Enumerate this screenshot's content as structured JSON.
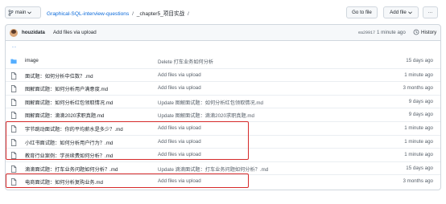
{
  "colors": {
    "link": "#0969da",
    "folder": "#54aeff",
    "highlight": "#d62a2a",
    "muted": "#57606a"
  },
  "header": {
    "branch": "main",
    "breadcrumb": {
      "repo": "Graphical-SQL-interview-questions",
      "folder": "_chapter5_项目实战",
      "trail": "/"
    },
    "goto_label": "Go to file",
    "addfile_label": "Add file",
    "more_label": "···"
  },
  "latest_commit": {
    "author": "houzidata",
    "message": "Add files via upload",
    "sha": "ea29917",
    "time": "1 minute ago",
    "history_label": "History"
  },
  "parent_link": "..",
  "files": [
    {
      "icon": "folder-icon",
      "name": "image",
      "message": "Delete 打车业务如何分析",
      "age": "15 days ago"
    },
    {
      "icon": "file-icon",
      "name": "面试题：如何分析中位数？.md",
      "message": "Add files via upload",
      "age": "1 minute ago"
    },
    {
      "icon": "file-icon",
      "name": "图解面试题：如何分析用户满意度.md",
      "message": "Add files via upload",
      "age": "3 months ago"
    },
    {
      "icon": "file-icon",
      "name": "图解面试题：如何分析红包领取情况.md",
      "message": "Update 图解面试题：如何分析红包领取情况.md",
      "age": "9 days ago"
    },
    {
      "icon": "file-icon",
      "name": "图解面试题：滴滴2020求职真题.md",
      "message": "Update 图解面试题：滴滴2020求职真题.md",
      "age": "9 days ago"
    },
    {
      "icon": "file-icon",
      "name": "字节跳动面试题：你的平均薪水是多少？.md",
      "message": "Add files via upload",
      "age": "1 minute ago"
    },
    {
      "icon": "file-icon",
      "name": "小红书面试题：如何分析用户行为？.md",
      "message": "Add files via upload",
      "age": "1 minute ago"
    },
    {
      "icon": "file-icon",
      "name": "教育行业案例：学员续费如何分析？.md",
      "message": "Add files via upload",
      "age": "1 minute ago"
    },
    {
      "icon": "file-icon",
      "name": "滴滴面试题：打车业务问题如何分析？.md",
      "message": "Update 滴滴面试题：打车业务问题如何分析？.md",
      "age": "15 days ago"
    },
    {
      "icon": "file-icon",
      "name": "电商面试题：如何分析复购业务.md",
      "message": "Add files via upload",
      "age": "3 months ago"
    }
  ]
}
